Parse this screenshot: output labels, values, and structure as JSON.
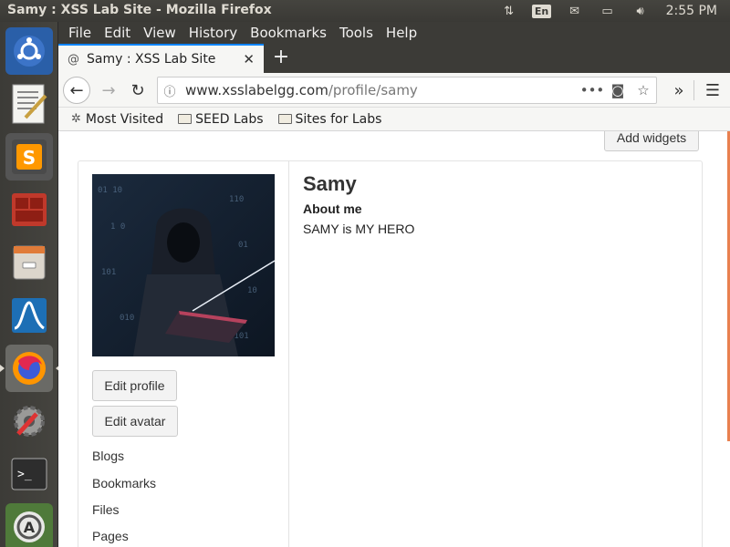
{
  "system_panel": {
    "window_title": "Samy : XSS Lab Site - Mozilla Firefox",
    "keyboard_layout": "En",
    "clock": "2:55 PM",
    "tray_icons": [
      "network-arrows-icon",
      "keyboard-layout-icon",
      "mail-icon",
      "battery-icon",
      "volume-icon"
    ]
  },
  "launcher": {
    "items": [
      "ubuntu-dash-icon",
      "text-editor-icon",
      "sublime-text-icon",
      "terminal-emulator-icon",
      "file-manager-icon",
      "wireshark-icon",
      "firefox-icon",
      "system-settings-icon",
      "terminal-icon",
      "software-updater-icon"
    ]
  },
  "browser": {
    "menu": [
      "File",
      "Edit",
      "View",
      "History",
      "Bookmarks",
      "Tools",
      "Help"
    ],
    "tab": {
      "title": "Samy : XSS Lab Site"
    },
    "url": {
      "host": "www.xsslabelgg.com",
      "path": "/profile/samy"
    },
    "bookmarks": [
      "Most Visited",
      "SEED Labs",
      "Sites for Labs"
    ]
  },
  "page": {
    "add_widgets": "Add widgets",
    "profile_name": "Samy",
    "about_label": "About me",
    "about_value": "SAMY is MY HERO",
    "edit_profile": "Edit profile",
    "edit_avatar": "Edit avatar",
    "owner_links": [
      "Blogs",
      "Bookmarks",
      "Files",
      "Pages"
    ]
  },
  "colors": {
    "tab_accent": "#0a84ff",
    "scroll_indicator": "#e9804f",
    "ubuntu_panel": "#3c3b37"
  }
}
